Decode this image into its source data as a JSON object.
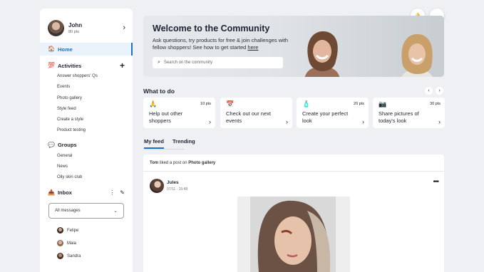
{
  "profile": {
    "name": "John",
    "points": "80 pts"
  },
  "nav": {
    "home": "Home",
    "activities": {
      "title": "Activities",
      "items": [
        "Answer shoppers' Qs",
        "Events",
        "Photo gallery",
        "Style feed",
        "Create a style",
        "Product testing"
      ]
    },
    "groups": {
      "title": "Groups",
      "items": [
        "General",
        "News",
        "Oily skin club"
      ]
    },
    "inbox": {
      "title": "Inbox",
      "filter": "All messages",
      "people": [
        "Felipe",
        "Maia",
        "Sandra"
      ]
    }
  },
  "hero": {
    "title": "Welcome to the Community",
    "subtitle": "Ask questions, try products for free & join challenges with fellow shoppers! See how to get started",
    "link": "here",
    "search_placeholder": "Search on the community"
  },
  "what_to_do": {
    "title": "What to do",
    "cards": [
      {
        "icon": "🙏",
        "points": "10 pts",
        "label": "Help out other shoppers"
      },
      {
        "icon": "📅",
        "points": "",
        "label": "Check out our next events"
      },
      {
        "icon": "🧴",
        "points": "20 pts",
        "label": "Create your perfect look"
      },
      {
        "icon": "📷",
        "points": "30 pts",
        "label": "Share pictures of today's look"
      }
    ]
  },
  "tabs": [
    "My feed",
    "Trending"
  ],
  "feed": {
    "actor": "Tom",
    "action": " liked a post on ",
    "target": "Photo gallery",
    "post": {
      "author": "Jules",
      "time": "07/11 - 15:48"
    }
  },
  "colors": {
    "accent": "#1a73c9"
  }
}
